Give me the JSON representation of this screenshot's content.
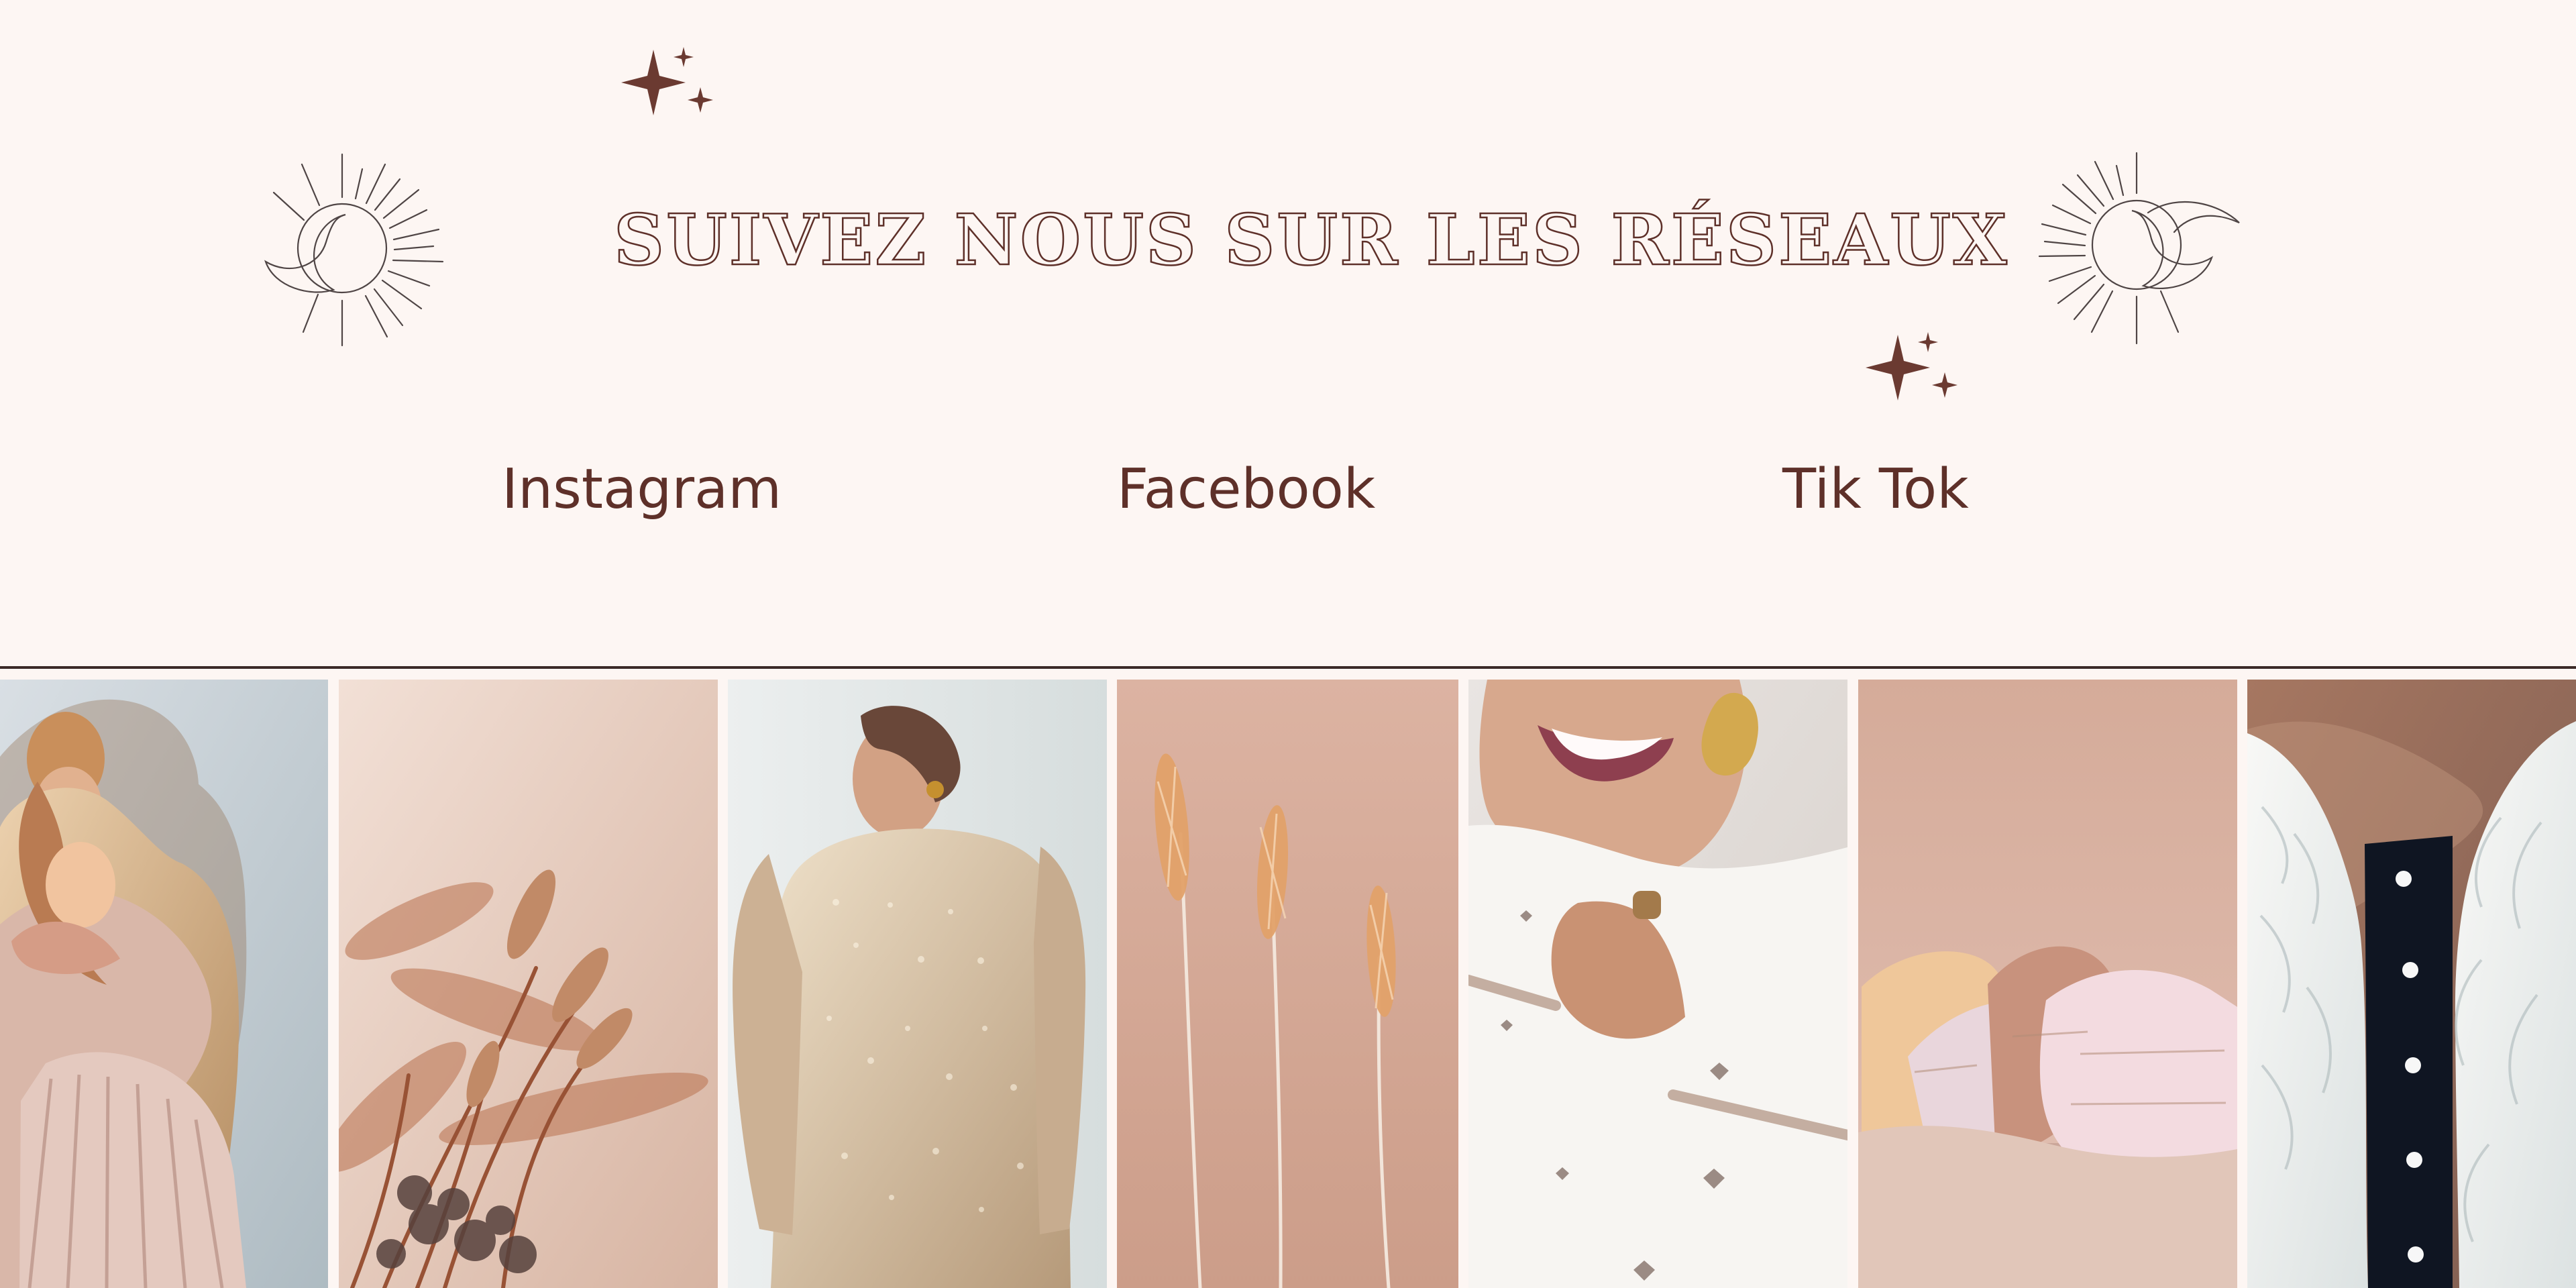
{
  "page": {
    "heading": "SUIVEZ NOUS SUR LES RÉSEAUX",
    "colors": {
      "background": "#fdf6f3",
      "text": "#5e3029",
      "divider": "#3b2a28",
      "star": "#6b3a31"
    }
  },
  "social_links": [
    {
      "label": "Instagram"
    },
    {
      "label": "Facebook"
    },
    {
      "label": "Tik Tok"
    }
  ],
  "decorations": [
    {
      "icon": "sun-moon-icon"
    },
    {
      "icon": "sun-moon-icon"
    },
    {
      "icon": "sparkle-icon"
    },
    {
      "icon": "sparkle-icon"
    }
  ],
  "gallery": {
    "photos": [
      {
        "subject": "mother and child in sequins and pleats"
      },
      {
        "subject": "dried grasses"
      },
      {
        "subject": "woman in gold sequin dress"
      },
      {
        "subject": "wheat stems"
      },
      {
        "subject": "smiling woman with gold earrings and heart sweater"
      },
      {
        "subject": "folded knitwear"
      },
      {
        "subject": "white lace cardigan close-up"
      }
    ]
  }
}
